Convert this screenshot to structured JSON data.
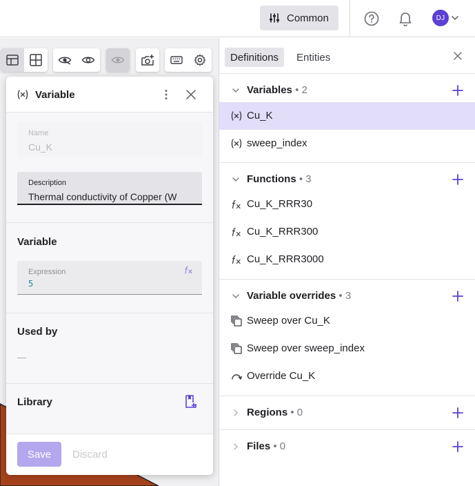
{
  "topbar": {
    "common_label": "Common",
    "avatar_initials": "DJ"
  },
  "variable_panel": {
    "title": "Variable",
    "name_label": "Name",
    "name_value": "Cu_K",
    "description_label": "Description",
    "description_value": "Thermal conductivity of Copper (W",
    "variable_section_title": "Variable",
    "expression_label": "Expression",
    "expression_value": "5",
    "used_by_title": "Used by",
    "used_by_value": "—",
    "library_title": "Library",
    "save_label": "Save",
    "discard_label": "Discard"
  },
  "right_panel": {
    "tabs": [
      {
        "label": "Definitions",
        "selected": true
      },
      {
        "label": "Entities",
        "selected": false
      }
    ],
    "groups": {
      "variables": {
        "title": "Variables",
        "count": "• 2",
        "items": [
          "Cu_K",
          "sweep_index"
        ]
      },
      "functions": {
        "title": "Functions",
        "count": "• 3",
        "items": [
          "Cu_K_RRR30",
          "Cu_K_RRR300",
          "Cu_K_RRR3000"
        ]
      },
      "overrides": {
        "title": "Variable overrides",
        "count": "• 3",
        "items": [
          "Sweep over Cu_K",
          "Sweep over sweep_index",
          "Override Cu_K"
        ]
      },
      "regions": {
        "title": "Regions",
        "count": "• 0"
      },
      "files": {
        "title": "Files",
        "count": "•  0"
      }
    }
  },
  "colors": {
    "accent": "#5b3fd6",
    "selection": "#e2ddf8",
    "save_disabled": "#b4a7ed",
    "geometry_fill": "#a6431c"
  },
  "icons": {
    "common": "sliders-icon",
    "help": "help-circle-icon",
    "notifications": "bell-icon",
    "variable": "variable-x-icon",
    "function": "function-fx-icon",
    "sweep": "sweep-copy-icon",
    "override": "override-arrow-icon",
    "add": "plus-icon",
    "close": "close-icon"
  }
}
